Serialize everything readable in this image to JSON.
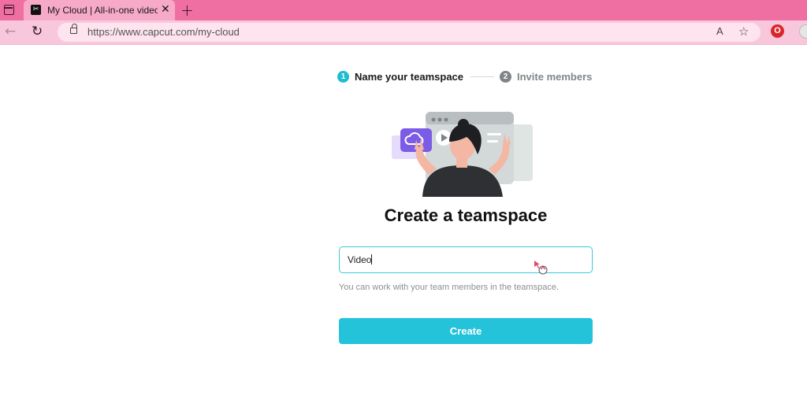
{
  "browser": {
    "tab_title": "My Cloud | All-in-one video edito",
    "favicon_glyph": "✂",
    "close_glyph": "✕",
    "new_tab_glyph": "+",
    "url": "https://www.capcut.com/my-cloud",
    "back_glyph": "←",
    "reload_glyph": "↻",
    "read_aloud_glyph": "A",
    "favorite_glyph": "☆",
    "extension_glyph": "O",
    "colors": {
      "tabbar": "#f06fa3",
      "navbar": "#f9c7db",
      "active_tab": "#f7a9c8"
    }
  },
  "stepper": {
    "steps": [
      {
        "number": "1",
        "label": "Name your teamspace",
        "active": true
      },
      {
        "number": "2",
        "label": "Invite members",
        "active": false
      }
    ]
  },
  "main": {
    "title": "Create a teamspace",
    "input_value": "Video",
    "hint": "You can work with your team members in the teamspace.",
    "create_label": "Create",
    "accent_color": "#25c3d9"
  },
  "icons": {
    "illustration": "person-with-cloud-video-illustration",
    "cursor": "busy-cursor-icon"
  }
}
